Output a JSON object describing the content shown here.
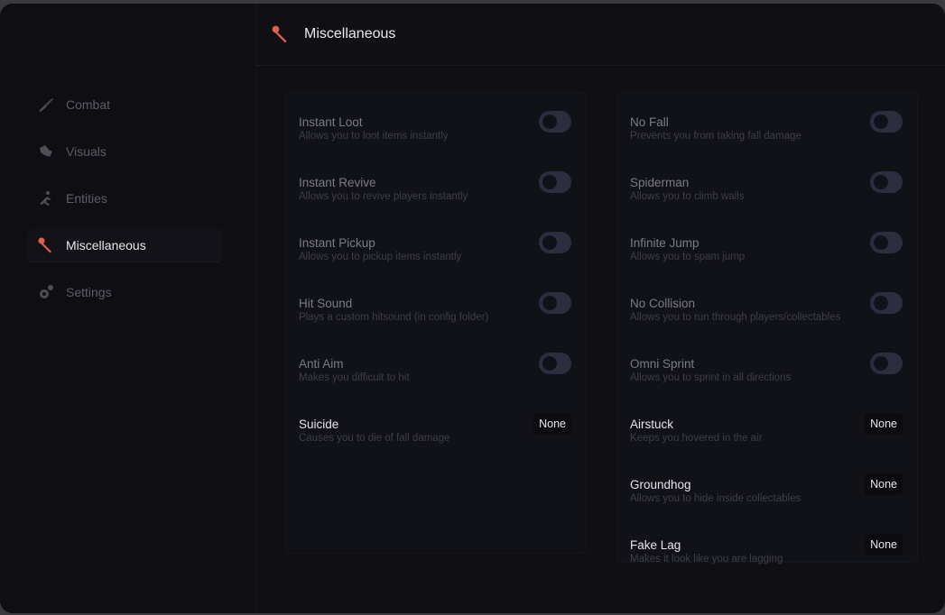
{
  "header": {
    "title": "Miscellaneous",
    "icon": "wrench-icon"
  },
  "sidebar": {
    "items": [
      {
        "label": "Combat",
        "icon": "rifle-icon"
      },
      {
        "label": "Visuals",
        "icon": "eye-icon"
      },
      {
        "label": "Entities",
        "icon": "entity-icon"
      },
      {
        "label": "Miscellaneous",
        "icon": "wrench-icon"
      },
      {
        "label": "Settings",
        "icon": "gear-icon"
      }
    ]
  },
  "left": [
    {
      "name": "Instant Loot",
      "desc": "Allows you to loot items instantly",
      "control": "toggle",
      "on": false
    },
    {
      "name": "Instant Revive",
      "desc": "Allows you to revive players instantly",
      "control": "toggle",
      "on": false
    },
    {
      "name": "Instant Pickup",
      "desc": "Allows you to pickup items instantly",
      "control": "toggle",
      "on": false
    },
    {
      "name": "Hit Sound",
      "desc": "Plays a custom hitsound (in config folder)",
      "control": "toggle",
      "on": false
    },
    {
      "name": "Anti Aim",
      "desc": "Makes you difficult to hit",
      "control": "toggle",
      "on": false
    },
    {
      "name": "Suicide",
      "desc": "Causes you to die of fall damage",
      "control": "key",
      "value": "None"
    }
  ],
  "right": [
    {
      "name": "No Fall",
      "desc": "Prevents you from taking fall damage",
      "control": "toggle",
      "on": false
    },
    {
      "name": "Spiderman",
      "desc": "Allows you to climb walls",
      "control": "toggle",
      "on": false
    },
    {
      "name": "Infinite Jump",
      "desc": "Allows you to spam jump",
      "control": "toggle",
      "on": false
    },
    {
      "name": "No Collision",
      "desc": "Allows you to run through players/collectables",
      "control": "toggle",
      "on": false
    },
    {
      "name": "Omni Sprint",
      "desc": "Allows you to sprint in all directions",
      "control": "toggle",
      "on": false
    },
    {
      "name": "Airstuck",
      "desc": "Keeps you hovered in the air",
      "control": "key",
      "value": "None"
    },
    {
      "name": "Groundhog",
      "desc": "Allows you to hide inside collectables",
      "control": "key",
      "value": "None"
    },
    {
      "name": "Fake Lag",
      "desc": "Makes it look like you are lagging",
      "control": "key",
      "value": "None"
    }
  ],
  "colors": {
    "accent": "#e0604a",
    "toggle_off": "#2a2e3f",
    "background": "#0f0f14"
  }
}
